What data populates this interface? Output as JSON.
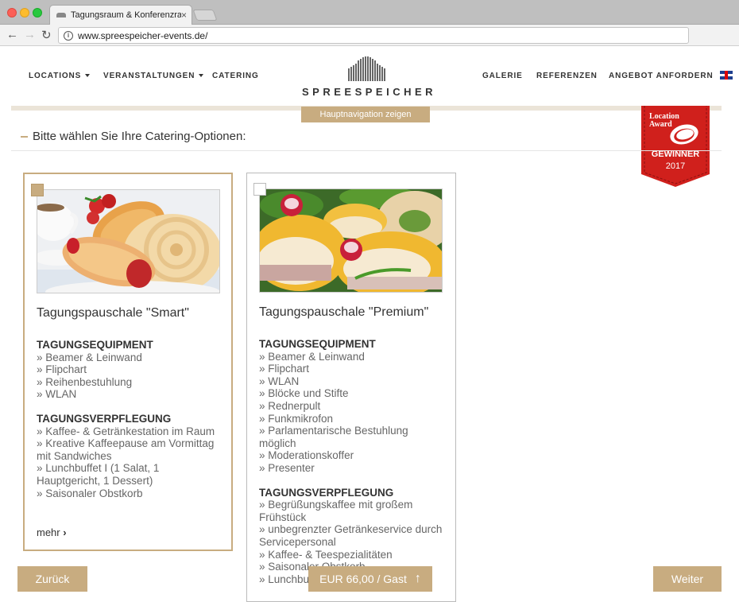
{
  "browser": {
    "tab_title": "Tagungsraum & Konferenzraum",
    "url": "www.spreespeicher-events.de/"
  },
  "header": {
    "nav_left": [
      {
        "label": "LOCATIONS",
        "has_dropdown": true
      },
      {
        "label": "VERANSTALTUNGEN",
        "has_dropdown": true
      },
      {
        "label": "CATERING",
        "has_dropdown": false
      }
    ],
    "logo_text": "SPREESPEICHER",
    "nav_right": [
      {
        "label": "GALERIE"
      },
      {
        "label": "REFERENZEN"
      },
      {
        "label": "ANGEBOT ANFORDERN"
      }
    ],
    "language_flag": "uk-flag-icon",
    "hauptnav_button": "Hauptnavigation zeigen"
  },
  "award_badge": {
    "line1": "Location",
    "line2": "Award",
    "status": "GEWINNER",
    "year": "2017",
    "color": "#d0201c"
  },
  "section": {
    "title": "Bitte wählen Sie Ihre Catering-Optionen:"
  },
  "cards": [
    {
      "title": "Tagungspauschale \"Smart\"",
      "selected": true,
      "image": "pastries-photo",
      "groups": [
        {
          "heading": "TAGUNGSEQUIPMENT",
          "items": [
            "» Beamer & Leinwand",
            "» Flipchart",
            "» Reihenbestuhlung",
            "» WLAN"
          ]
        },
        {
          "heading": "TAGUNGSVERPFLEGUNG",
          "items": [
            "» Kaffee- & Getränkestation im Raum",
            "» Kreative Kaffeepause am Vormittag mit Sandwiches",
            "» Lunchbuffet I (1 Salat, 1 Hauptgericht, 1 Dessert)",
            "» Saisonaler Obstkorb"
          ]
        }
      ],
      "more_label": "mehr"
    },
    {
      "title": "Tagungspauschale \"Premium\"",
      "selected": false,
      "image": "sandwiches-photo",
      "groups": [
        {
          "heading": "TAGUNGSEQUIPMENT",
          "items": [
            "» Beamer & Leinwand",
            "» Flipchart",
            "» WLAN",
            "» Blöcke und Stifte",
            "» Rednerpult",
            "» Funkmikrofon",
            "» Parlamentarische Bestuhlung möglich",
            "» Moderationskoffer",
            "» Presenter"
          ]
        },
        {
          "heading": "TAGUNGSVERPFLEGUNG",
          "items": [
            "» Begrüßungskaffee mit großem Frühstück",
            "» unbegrenzter Getränkeservice durch Servicepersonal",
            "» Kaffee- & Teespezialitäten",
            "» Saisonaler Obstkorb",
            "» Lunchbuffet"
          ]
        }
      ]
    }
  ],
  "footer": {
    "back_label": "Zurück",
    "price_label": "EUR 66,00 / Gast",
    "next_label": "Weiter"
  },
  "colors": {
    "accent": "#c8ac80",
    "award_red": "#d0201c"
  }
}
